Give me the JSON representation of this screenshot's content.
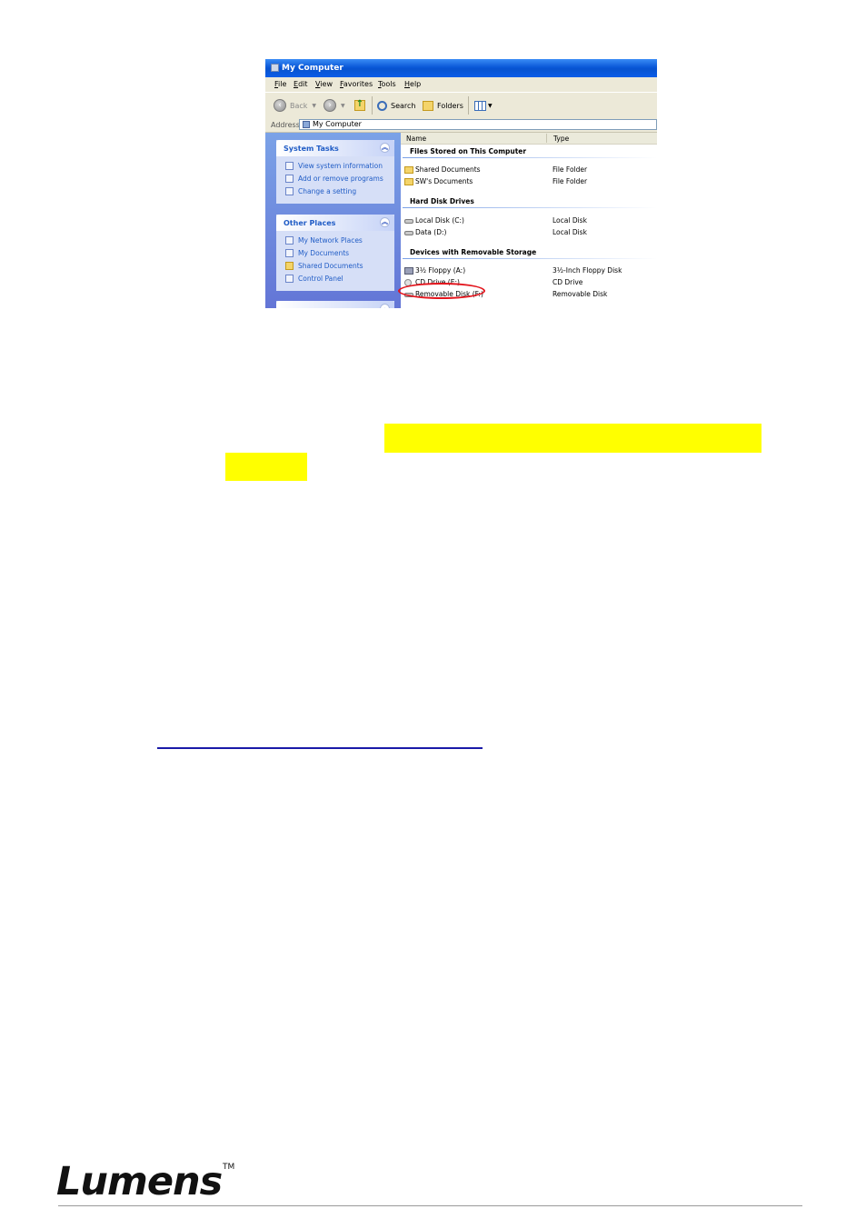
{
  "window": {
    "title": "My Computer",
    "menu": [
      "File",
      "Edit",
      "View",
      "Favorites",
      "Tools",
      "Help"
    ],
    "toolbar": {
      "back_label": "Back",
      "search_label": "Search",
      "folders_label": "Folders"
    },
    "address": {
      "label": "Address",
      "value": "My Computer"
    },
    "left_panes": [
      {
        "title": "System Tasks",
        "links": [
          "View system information",
          "Add or remove programs",
          "Change a setting"
        ]
      },
      {
        "title": "Other Places",
        "links": [
          "My Network Places",
          "My Documents",
          "Shared Documents",
          "Control Panel"
        ]
      }
    ],
    "columns": {
      "name": "Name",
      "type": "Type"
    },
    "groups": [
      {
        "title": "Files Stored on This Computer",
        "items": [
          {
            "name": "Shared Documents",
            "type": "File Folder",
            "icon": "folder-icon"
          },
          {
            "name": "SW's Documents",
            "type": "File Folder",
            "icon": "folder-icon"
          }
        ]
      },
      {
        "title": "Hard Disk Drives",
        "items": [
          {
            "name": "Local Disk (C:)",
            "type": "Local Disk",
            "icon": "hard-disk-icon"
          },
          {
            "name": "Data (D:)",
            "type": "Local Disk",
            "icon": "hard-disk-icon"
          }
        ]
      },
      {
        "title": "Devices with Removable Storage",
        "items": [
          {
            "name": "3½ Floppy (A:)",
            "type": "3½-Inch Floppy Disk",
            "icon": "floppy-icon"
          },
          {
            "name": "CD Drive (E:)",
            "type": "CD Drive",
            "icon": "cd-drive-icon"
          },
          {
            "name": "Removable Disk (F:)",
            "type": "Removable Disk",
            "icon": "removable-disk-icon"
          }
        ]
      }
    ],
    "highlight_color": "#e3141c"
  },
  "annotation_color": "#ffff00",
  "brand": {
    "logo_text": "Lumens",
    "trademark": "TM"
  }
}
